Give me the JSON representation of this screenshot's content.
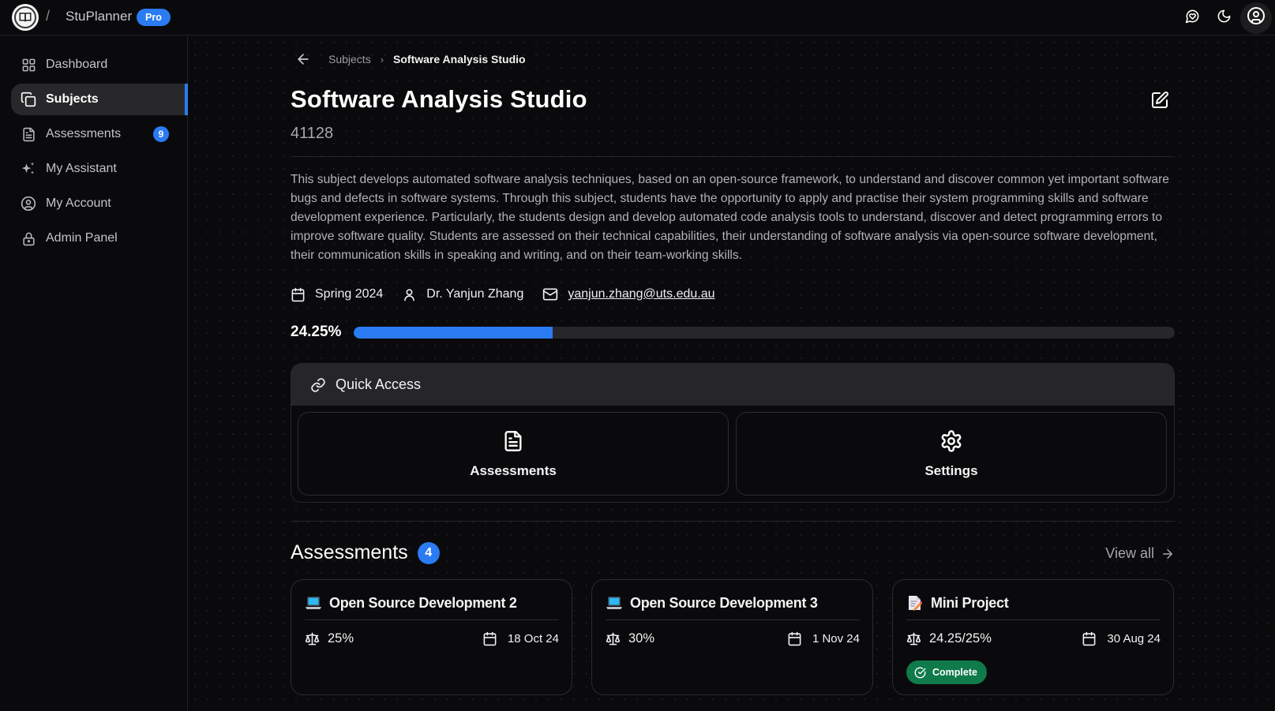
{
  "app": {
    "name": "StuPlanner",
    "plan_badge": "Pro",
    "separator": "/"
  },
  "topbar": {
    "icons": [
      "feedback-heart-icon",
      "dark-mode-moon-icon",
      "user-account-icon"
    ]
  },
  "sidebar": {
    "items": [
      {
        "label": "Dashboard",
        "icon": "dashboard-grid-icon",
        "active": false
      },
      {
        "label": "Subjects",
        "icon": "subjects-copy-icon",
        "active": true
      },
      {
        "label": "Assessments",
        "icon": "file-text-icon",
        "active": false,
        "badge": "9"
      },
      {
        "label": "My Assistant",
        "icon": "sparkles-icon",
        "active": false
      },
      {
        "label": "My Account",
        "icon": "user-circle-icon",
        "active": false
      },
      {
        "label": "Admin Panel",
        "icon": "lock-icon",
        "active": false
      }
    ]
  },
  "breadcrumb": {
    "parent": "Subjects",
    "separator": "›",
    "current": "Software Analysis Studio"
  },
  "subject": {
    "title": "Software Analysis Studio",
    "code": "41128",
    "description": "This subject develops automated software analysis techniques, based on an open-source framework, to understand and discover common yet important software bugs and defects in software systems. Through this subject, students have the opportunity to apply and practise their system programming skills and software development experience. Particularly, the students design and develop automated code analysis tools to understand, discover and detect programming errors to improve software quality. Students are assessed on their technical capabilities, their understanding of software analysis via open-source software development, their communication skills in speaking and writing, and on their team-working skills.",
    "term": "Spring 2024",
    "coordinator": "Dr. Yanjun Zhang",
    "email": "yanjun.zhang@uts.edu.au",
    "progress_label": "24.25%",
    "progress_percent": 24.25
  },
  "quick_access": {
    "title": "Quick Access",
    "tiles": [
      {
        "label": "Assessments",
        "icon": "file-text-icon"
      },
      {
        "label": "Settings",
        "icon": "gear-icon"
      }
    ]
  },
  "assessments": {
    "title": "Assessments",
    "count": "4",
    "view_all": "View all",
    "items": [
      {
        "emoji": "laptop",
        "title": "Open Source Development 2",
        "weight": "25%",
        "due": "18 Oct 24"
      },
      {
        "emoji": "laptop",
        "title": "Open Source Development 3",
        "weight": "30%",
        "due": "1 Nov 24"
      },
      {
        "emoji": "memo",
        "title": "Mini Project",
        "weight": "24.25/25%",
        "due": "30 Aug 24",
        "status": "Complete"
      }
    ]
  },
  "colors": {
    "accent": "#2b7bf2",
    "complete": "#0f7a4a",
    "background": "#0a0a0c"
  }
}
